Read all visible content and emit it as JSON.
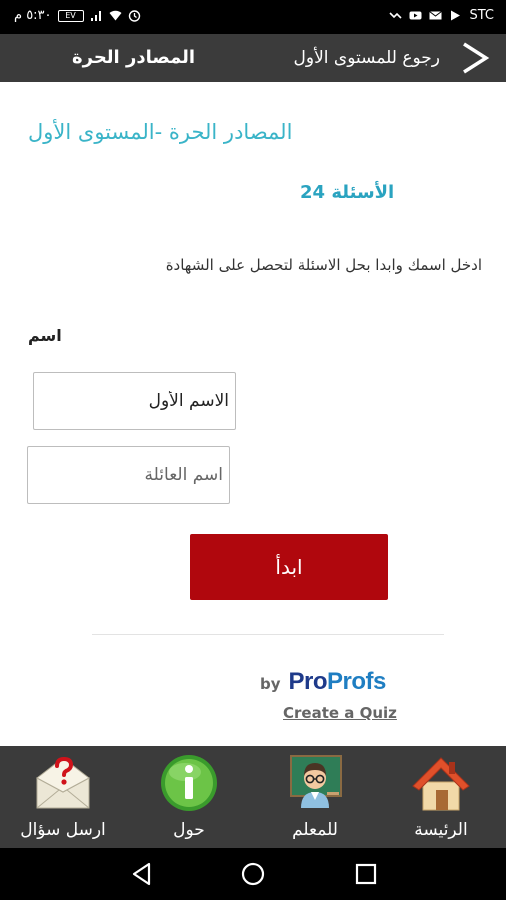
{
  "status_bar": {
    "time": "٥:٣٠ م",
    "battery": "EV",
    "carrier": "STC",
    "icons_left": [
      "battery-icon",
      "signal-icon",
      "wifi-icon",
      "alarm-icon"
    ],
    "icons_right": [
      "missed-call-icon",
      "youtube-icon",
      "mail-icon",
      "play-store-icon"
    ]
  },
  "header": {
    "title": "المصادر الحرة",
    "back_label": "رجوع للمستوى الأول"
  },
  "quiz": {
    "title": "المصادر الحرة -المستوى الأول",
    "questions_count": "الأسئلة 24",
    "instructions": "ادخل اسمك وابدا بحل الاسئلة لتحصل على الشهادة",
    "name_label": "اسم",
    "first_name_value": "الاسم الأول",
    "last_name_placeholder": "اسم العائلة",
    "start_label": "ابدأ"
  },
  "footer": {
    "by": "by",
    "brand_pro": "Pro",
    "brand_profs": "Profs",
    "create_quiz": "Create a Quiz"
  },
  "tabs": [
    {
      "label": "ارسل سؤال",
      "icon": "envelope-question-icon"
    },
    {
      "label": "حول",
      "icon": "info-icon"
    },
    {
      "label": "للمعلم",
      "icon": "teacher-icon"
    },
    {
      "label": "الرئيسة",
      "icon": "home-icon"
    }
  ],
  "colors": {
    "accent": "#3ab4c8",
    "start_button": "#b0070d",
    "bar_background": "#3b3b3b"
  }
}
